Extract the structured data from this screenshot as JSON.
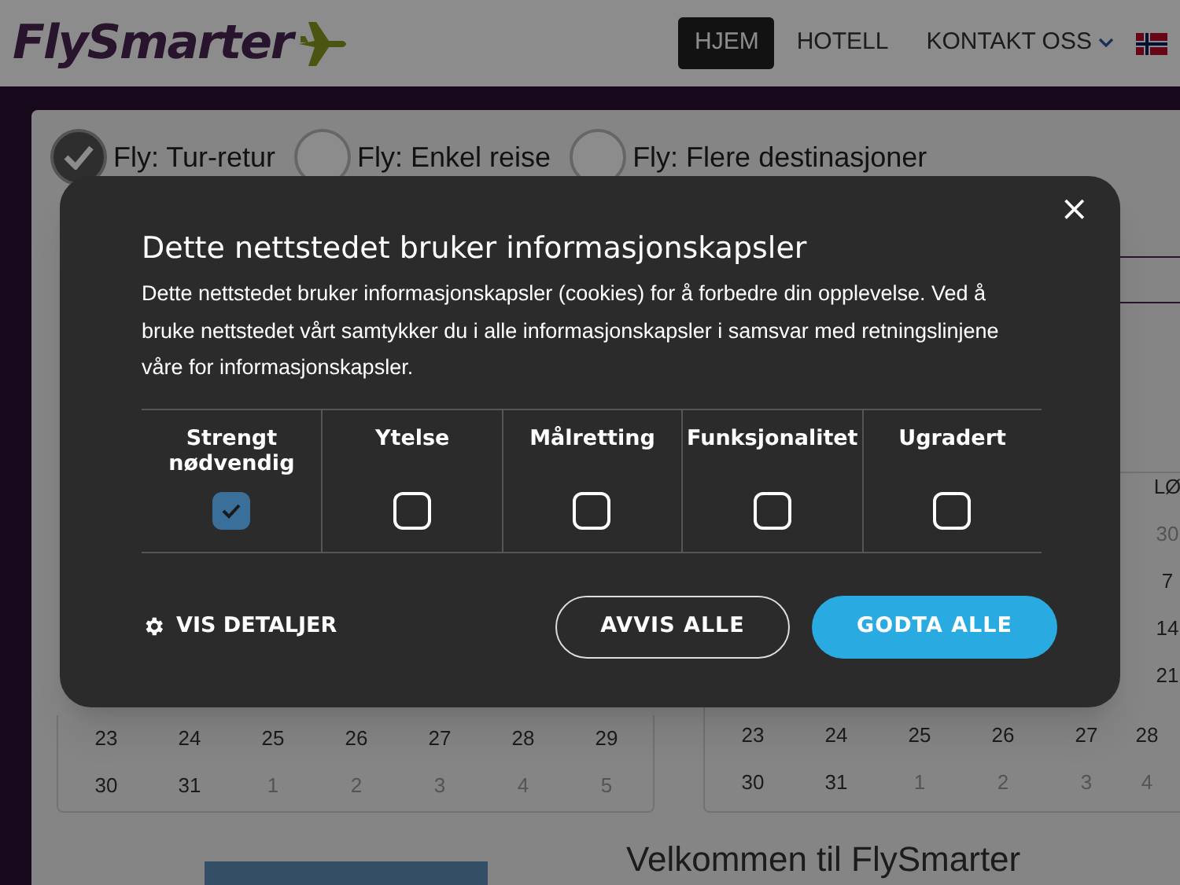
{
  "header": {
    "logo": "FlySmarter",
    "nav": [
      {
        "label": "HJEM",
        "selected": true
      },
      {
        "label": "HOTELL",
        "selected": false
      },
      {
        "label": "KONTAKT OSS",
        "selected": false,
        "dropdown": true
      }
    ]
  },
  "trip_types": [
    {
      "label": "Fly: Tur-retur",
      "selected": true
    },
    {
      "label": "Fly: Enkel reise",
      "selected": false
    },
    {
      "label": "Fly: Flere destinasjoner",
      "selected": false
    }
  ],
  "calendars": [
    {
      "rows": [
        [
          {
            "day": "23",
            "muted": false
          },
          {
            "day": "24",
            "muted": false
          },
          {
            "day": "25",
            "muted": false
          },
          {
            "day": "26",
            "muted": false
          },
          {
            "day": "27",
            "muted": false
          },
          {
            "day": "28",
            "muted": false
          },
          {
            "day": "29",
            "muted": false
          }
        ],
        [
          {
            "day": "30",
            "muted": false
          },
          {
            "day": "31",
            "muted": false
          },
          {
            "day": "1",
            "muted": true
          },
          {
            "day": "2",
            "muted": true
          },
          {
            "day": "3",
            "muted": true
          },
          {
            "day": "4",
            "muted": true
          },
          {
            "day": "5",
            "muted": true
          }
        ]
      ]
    },
    {
      "side_column": [
        {
          "day": "LØ",
          "muted": false
        },
        {
          "day": "30",
          "muted": true
        },
        {
          "day": "7",
          "muted": false
        },
        {
          "day": "14",
          "muted": false
        },
        {
          "day": "21",
          "muted": false
        }
      ],
      "rows": [
        [
          {
            "day": "23",
            "muted": false
          },
          {
            "day": "24",
            "muted": false
          },
          {
            "day": "25",
            "muted": false
          },
          {
            "day": "26",
            "muted": false
          },
          {
            "day": "27",
            "muted": false
          },
          {
            "day": "28",
            "muted": false
          }
        ],
        [
          {
            "day": "30",
            "muted": false
          },
          {
            "day": "31",
            "muted": false
          },
          {
            "day": "1",
            "muted": true
          },
          {
            "day": "2",
            "muted": true
          },
          {
            "day": "3",
            "muted": true
          },
          {
            "day": "4",
            "muted": true
          }
        ]
      ]
    }
  ],
  "welcome_heading": "Velkommen til FlySmarter",
  "cookie_dialog": {
    "title": "Dette nettstedet bruker informasjonskapsler",
    "body": "Dette nettstedet bruker informasjonskapsler (cookies) for å forbedre din opplevelse. Ved å bruke nettstedet vårt samtykker du i alle informasjonskapsler i samsvar med retningslinjene våre for informasjonskapsler.",
    "close": "×",
    "categories": [
      {
        "label": "Strengt nødvendig",
        "checked": true
      },
      {
        "label": "Ytelse",
        "checked": false
      },
      {
        "label": "Målretting",
        "checked": false
      },
      {
        "label": "Funksjonalitet",
        "checked": false
      },
      {
        "label": "Ugradert",
        "checked": false
      }
    ],
    "details_link": "VIS DETALJER",
    "buttons": [
      {
        "kind": "outline",
        "label": "AVVIS ALLE"
      },
      {
        "kind": "filled",
        "label": "GODTA ALLE"
      }
    ]
  }
}
